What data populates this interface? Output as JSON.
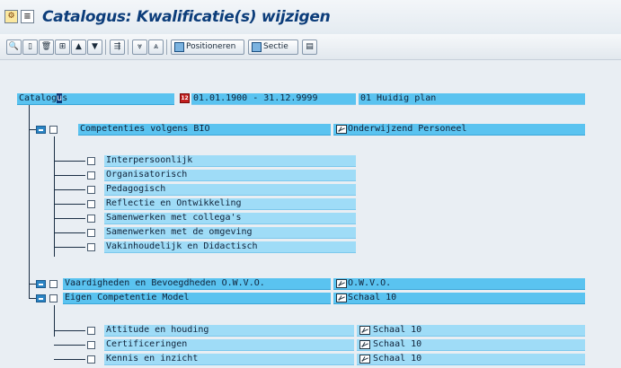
{
  "window": {
    "title": "Catalogus: Kwalificatie(s) wijzigen"
  },
  "toolbar": {
    "positioneren_label": "Positioneren",
    "sectie_label": "Sectie"
  },
  "root": {
    "label": "Catalogus",
    "period": "01.01.1900 - 31.12.9999",
    "plan": "01 Huidig plan"
  },
  "groups": [
    {
      "label": "Competenties volgens BIO",
      "ref": "Onderwijzend Personeel",
      "children": [
        {
          "label": "Interpersoonlijk"
        },
        {
          "label": "Organisatorisch"
        },
        {
          "label": "Pedagogisch"
        },
        {
          "label": "Reflectie en Ontwikkeling"
        },
        {
          "label": "Samenwerken met collega's"
        },
        {
          "label": "Samenwerken met de omgeving"
        },
        {
          "label": "Vakinhoudelijk en Didactisch"
        }
      ]
    },
    {
      "label": "Vaardigheden en Bevoegdheden O.W.V.O.",
      "ref": "O.W.V.O.",
      "children": []
    },
    {
      "label": "Eigen Competentie Model",
      "ref": "Schaal 10",
      "children": [
        {
          "label": "Attitude en houding",
          "ref": "Schaal 10"
        },
        {
          "label": "Certificeringen",
          "ref": "Schaal 10"
        },
        {
          "label": "Kennis en inzicht",
          "ref": "Schaal 10"
        }
      ]
    }
  ],
  "colors": {
    "field": "#5ac3f0",
    "field_light": "#9fdcf7",
    "title": "#0c3d7a"
  }
}
